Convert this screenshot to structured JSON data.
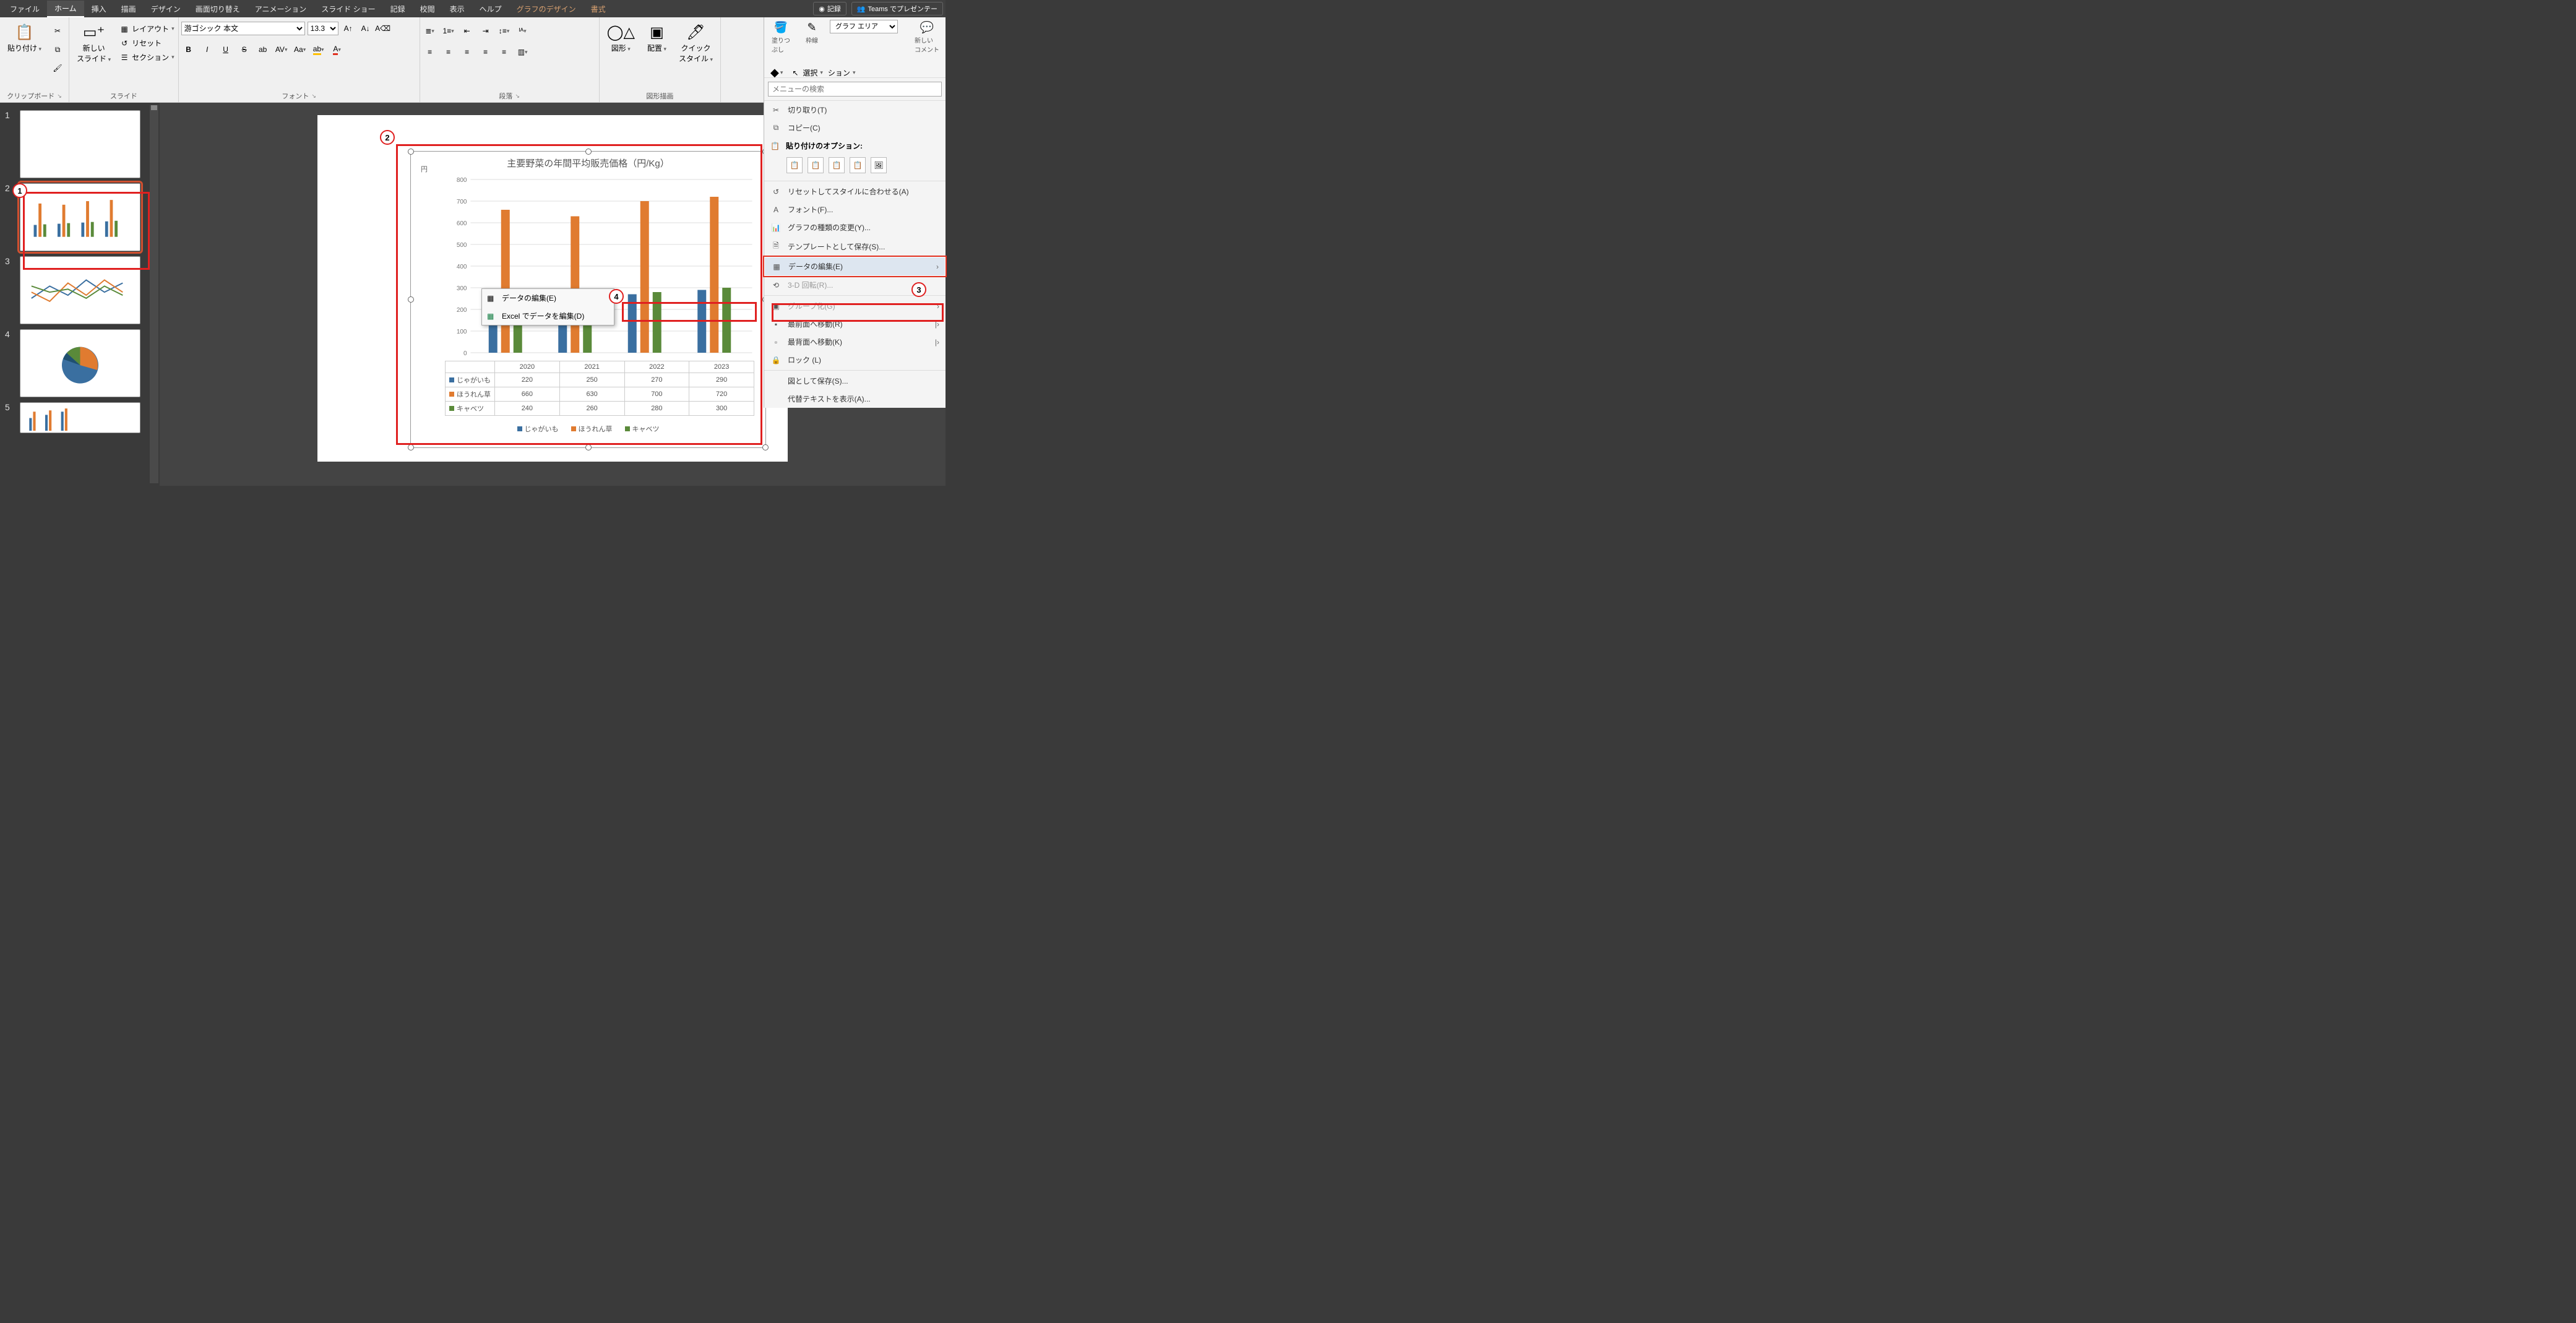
{
  "menubar": {
    "tabs": [
      "ファイル",
      "ホーム",
      "挿入",
      "描画",
      "デザイン",
      "画面切り替え",
      "アニメーション",
      "スライド ショー",
      "記録",
      "校閲",
      "表示",
      "ヘルプ",
      "グラフのデザイン",
      "書式"
    ],
    "active": "ホーム",
    "contextual": [
      "グラフのデザイン",
      "書式"
    ],
    "record": "記録",
    "teams": "Teams でプレゼンテー"
  },
  "ribbon": {
    "clipboard": {
      "paste": "貼り付け",
      "label": "クリップボード"
    },
    "slides": {
      "newSlide": "新しい\nスライド",
      "layout": "レイアウト",
      "reset": "リセット",
      "section": "セクション",
      "label": "スライド"
    },
    "font": {
      "family": "游ゴシック 本文",
      "size": "13.3",
      "label": "フォント"
    },
    "paragraph": {
      "label": "段落"
    },
    "drawing": {
      "shapes": "図形",
      "arrange": "配置",
      "quickStyles": "クイック\nスタイル",
      "label": "図形描画"
    },
    "format_pane": {
      "fill": "塗りつ\nぶし",
      "outline": "枠線",
      "chart_area": "グラフ エリア",
      "select": "選択",
      "newComment": "新しい\nコメント",
      "more": "ション"
    }
  },
  "thumbnails": {
    "count": 5,
    "selected": 2
  },
  "chart_data": {
    "type": "bar",
    "title": "主要野菜の年間平均販売価格（円/Kg）",
    "ylabel": "円",
    "ylim": [
      0,
      800
    ],
    "yticks": [
      0,
      100,
      200,
      300,
      400,
      500,
      600,
      700,
      800
    ],
    "categories": [
      "2020",
      "2021",
      "2022",
      "2023"
    ],
    "series": [
      {
        "name": "じゃがいも",
        "color": "#3a6fa0",
        "values": [
          220,
          250,
          270,
          290
        ]
      },
      {
        "name": "ほうれん草",
        "color": "#e07b30",
        "values": [
          660,
          630,
          700,
          720
        ]
      },
      {
        "name": "キャベツ",
        "color": "#5a8a3a",
        "values": [
          240,
          260,
          280,
          300
        ]
      }
    ]
  },
  "submenu": {
    "edit_data": "データの編集(E)",
    "edit_excel": "Excel でデータを編集(D)"
  },
  "context_menu": {
    "search_placeholder": "メニューの検索",
    "cut": "切り取り(T)",
    "copy": "コピー(C)",
    "paste_heading": "貼り付けのオプション:",
    "reset_style": "リセットしてスタイルに合わせる(A)",
    "font": "フォント(F)...",
    "change_chart_type": "グラフの種類の変更(Y)...",
    "save_template": "テンプレートとして保存(S)...",
    "edit_data": "データの編集(E)",
    "rotate_3d": "3-D 回転(R)...",
    "group": "グループ化(G)",
    "bring_front": "最前面へ移動(R)",
    "send_back": "最背面へ移動(K)",
    "lock": "ロック (L)",
    "save_as_picture": "図として保存(S)...",
    "alt_text": "代替テキストを表示(A)..."
  },
  "callouts": {
    "1": "1",
    "2": "2",
    "3": "3",
    "4": "4"
  }
}
